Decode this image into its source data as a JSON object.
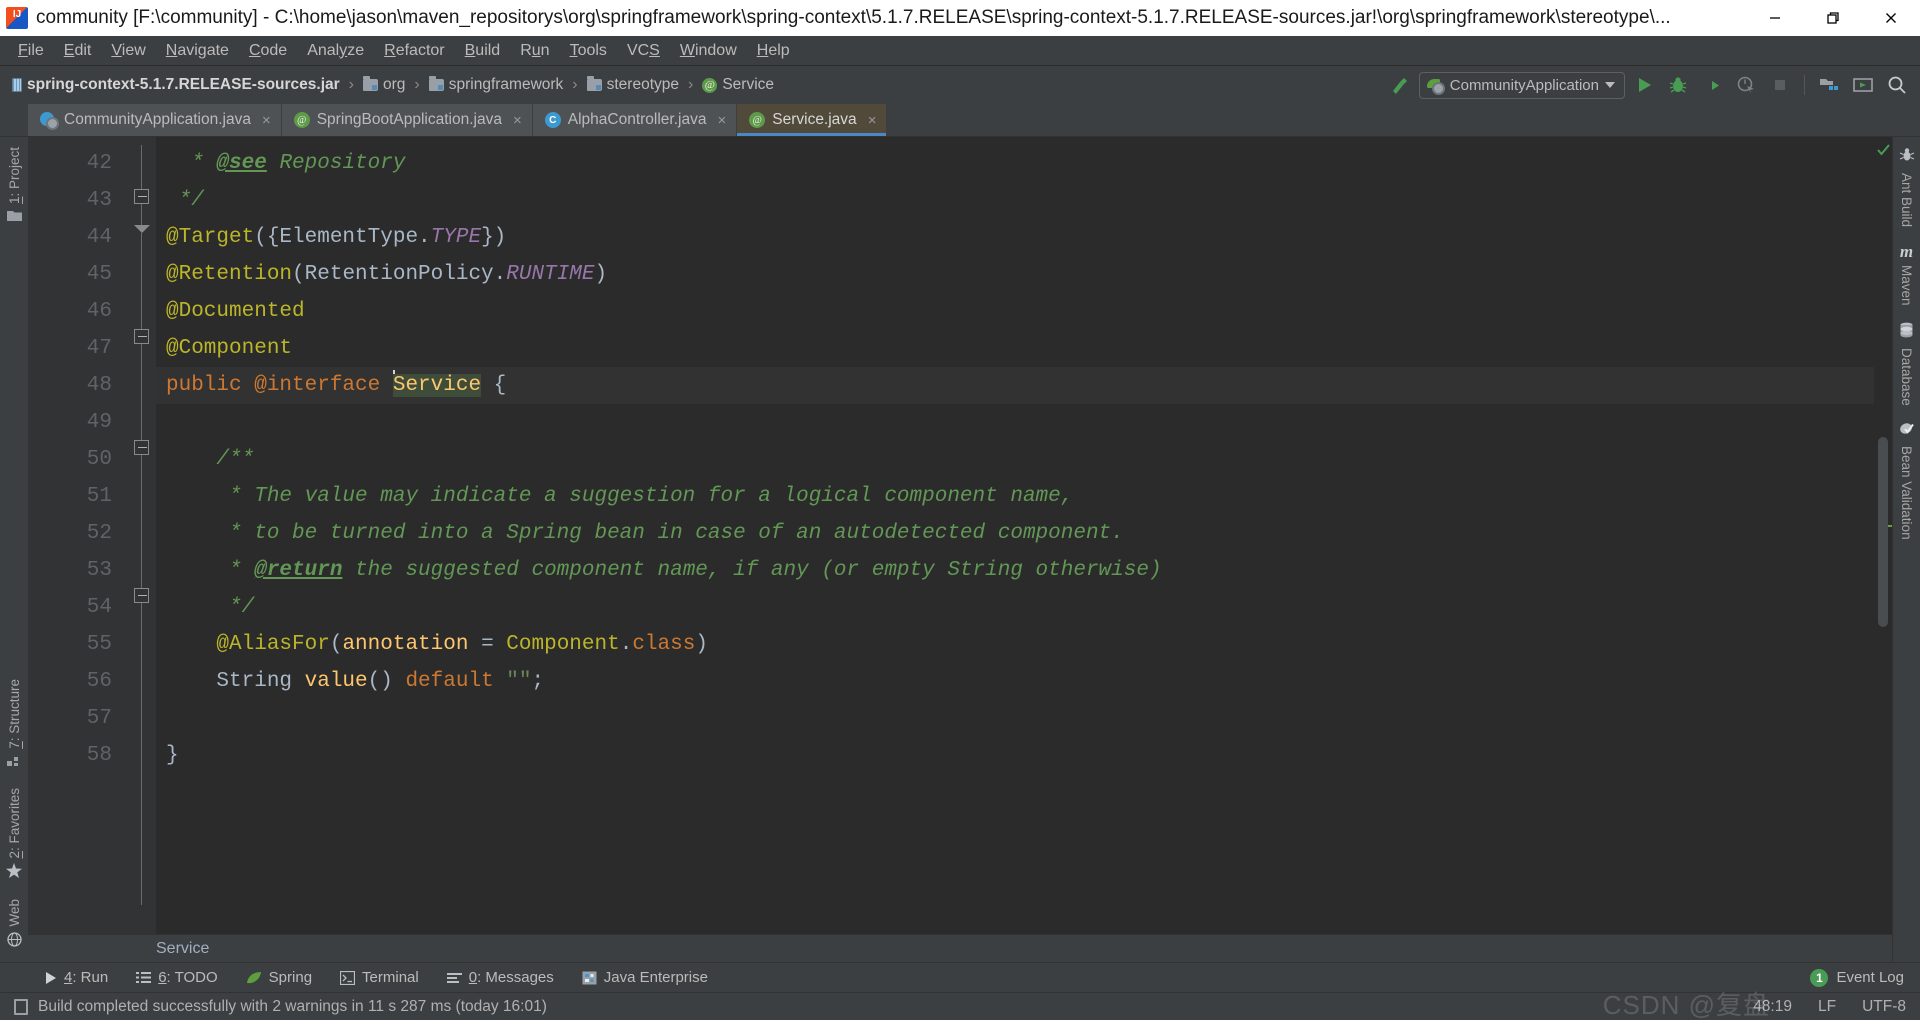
{
  "window": {
    "title": "community [F:\\community] - C:\\home\\jason\\maven_repositorys\\org\\springframework\\spring-context\\5.1.7.RELEASE\\spring-context-5.1.7.RELEASE-sources.jar!\\org\\springframework\\stereotype\\...",
    "app_icon": "intellij-idea-icon",
    "controls": {
      "minimize": "minimize-icon",
      "restore": "restore-icon",
      "close": "close-icon"
    }
  },
  "menubar": {
    "items": [
      {
        "pre": "",
        "mn": "F",
        "post": "ile"
      },
      {
        "pre": "",
        "mn": "E",
        "post": "dit"
      },
      {
        "pre": "",
        "mn": "V",
        "post": "iew"
      },
      {
        "pre": "",
        "mn": "N",
        "post": "avigate"
      },
      {
        "pre": "",
        "mn": "C",
        "post": "ode"
      },
      {
        "pre": "Anal",
        "mn": "y",
        "post": "ze"
      },
      {
        "pre": "",
        "mn": "R",
        "post": "efactor"
      },
      {
        "pre": "",
        "mn": "B",
        "post": "uild"
      },
      {
        "pre": "R",
        "mn": "u",
        "post": "n"
      },
      {
        "pre": "",
        "mn": "T",
        "post": "ools"
      },
      {
        "pre": "VC",
        "mn": "S",
        "post": ""
      },
      {
        "pre": "",
        "mn": "W",
        "post": "indow"
      },
      {
        "pre": "",
        "mn": "H",
        "post": "elp"
      }
    ]
  },
  "navbar": {
    "crumbs": [
      {
        "label": "spring-context-5.1.7.RELEASE-sources.jar",
        "icon": "jar-icon"
      },
      {
        "label": "org",
        "icon": "folder-icon"
      },
      {
        "label": "springframework",
        "icon": "folder-icon"
      },
      {
        "label": "stereotype",
        "icon": "folder-icon"
      },
      {
        "label": "Service",
        "icon": "annotation-icon"
      }
    ],
    "separator": "›",
    "run_config": {
      "label": "CommunityApplication",
      "icon": "spring-boot-icon",
      "dropdown": "chevron-down-icon"
    },
    "toolbar_icons": [
      "build-hammer-icon",
      "run-icon",
      "debug-icon",
      "run-coverage-icon",
      "profiler-icon",
      "stop-icon",
      "project-structure-icon",
      "open-terminal-icon",
      "search-icon"
    ]
  },
  "tabs": [
    {
      "label": "CommunityApplication.java",
      "icon": "spring-boot-class-icon",
      "close": "×",
      "active": false
    },
    {
      "label": "SpringBootApplication.java",
      "icon": "annotation-icon",
      "close": "×",
      "active": false
    },
    {
      "label": "AlphaController.java",
      "icon": "class-icon",
      "close": "×",
      "active": false
    },
    {
      "label": "Service.java",
      "icon": "annotation-icon",
      "close": "×",
      "active": true
    }
  ],
  "sidebar_left": [
    {
      "pre": "",
      "mn": "1",
      "post": ": Project",
      "icon": "folder-icon"
    },
    {
      "pre": "",
      "mn": "7",
      "post": ": Structure",
      "icon": "structure-icon"
    },
    {
      "pre": "",
      "mn": "2",
      "post": ": Favorites",
      "icon": "star-icon"
    },
    {
      "pre": "",
      "mn": "",
      "post": "Web",
      "icon": "web-globe-icon"
    }
  ],
  "sidebar_right": [
    {
      "label": "Ant Build",
      "icon": "ant-icon"
    },
    {
      "label": "Maven",
      "icon": "maven-m-icon"
    },
    {
      "label": "Database",
      "icon": "database-icon"
    },
    {
      "label": "Bean Validation",
      "icon": "bean-validation-icon"
    }
  ],
  "editor": {
    "first_line": 42,
    "lines": [
      {
        "num": 42,
        "current": false,
        "tokens": [
          {
            "t": "  * ",
            "c": "cmt"
          },
          {
            "t": "@see",
            "c": "cmt-tag"
          },
          {
            "t": " Repository",
            "c": "cmt"
          }
        ]
      },
      {
        "num": 43,
        "current": false,
        "tokens": [
          {
            "t": " */",
            "c": "cmt"
          }
        ]
      },
      {
        "num": 44,
        "current": false,
        "tokens": [
          {
            "t": "@Target",
            "c": "anno"
          },
          {
            "t": "({ElementType.",
            "c": "typ"
          },
          {
            "t": "TYPE",
            "c": "fld"
          },
          {
            "t": "})",
            "c": "typ"
          }
        ]
      },
      {
        "num": 45,
        "current": false,
        "tokens": [
          {
            "t": "@Retention",
            "c": "anno"
          },
          {
            "t": "(RetentionPolicy.",
            "c": "typ"
          },
          {
            "t": "RUNTIME",
            "c": "fld"
          },
          {
            "t": ")",
            "c": "typ"
          }
        ]
      },
      {
        "num": 46,
        "current": false,
        "tokens": [
          {
            "t": "@Documented",
            "c": "anno"
          }
        ]
      },
      {
        "num": 47,
        "current": false,
        "tokens": [
          {
            "t": "@Component",
            "c": "anno"
          }
        ]
      },
      {
        "num": 48,
        "current": true,
        "tokens": [
          {
            "t": "public ",
            "c": "kw"
          },
          {
            "t": "@interface ",
            "c": "kw"
          },
          {
            "t": "CARET",
            "c": "caret"
          },
          {
            "t": "Service",
            "c": "sel"
          },
          {
            "t": " {",
            "c": "typ"
          }
        ]
      },
      {
        "num": 49,
        "current": false,
        "tokens": []
      },
      {
        "num": 50,
        "current": false,
        "tokens": [
          {
            "t": "    /**",
            "c": "cmt"
          }
        ]
      },
      {
        "num": 51,
        "current": false,
        "tokens": [
          {
            "t": "     * The value may indicate a suggestion for a logical component name,",
            "c": "cmt"
          }
        ]
      },
      {
        "num": 52,
        "current": false,
        "tokens": [
          {
            "t": "     * to be turned into a Spring bean in case of an autodetected component.",
            "c": "cmt"
          }
        ]
      },
      {
        "num": 53,
        "current": false,
        "tokens": [
          {
            "t": "     * ",
            "c": "cmt"
          },
          {
            "t": "@return",
            "c": "cmt-tag"
          },
          {
            "t": " the suggested component name, if any (or empty String otherwise)",
            "c": "cmt"
          }
        ]
      },
      {
        "num": 54,
        "current": false,
        "tokens": [
          {
            "t": "     */",
            "c": "cmt"
          }
        ]
      },
      {
        "num": 55,
        "current": false,
        "tokens": [
          {
            "t": "    @AliasFor",
            "c": "anno"
          },
          {
            "t": "(",
            "c": "typ"
          },
          {
            "t": "annotation",
            "c": "ident"
          },
          {
            "t": " = ",
            "c": "typ"
          },
          {
            "t": "Component",
            "c": "anno"
          },
          {
            "t": ".",
            "c": "typ"
          },
          {
            "t": "class",
            "c": "kw"
          },
          {
            "t": ")",
            "c": "typ"
          }
        ]
      },
      {
        "num": 56,
        "current": false,
        "tokens": [
          {
            "t": "    String ",
            "c": "typ"
          },
          {
            "t": "value",
            "c": "ident"
          },
          {
            "t": "() ",
            "c": "typ"
          },
          {
            "t": "default ",
            "c": "kw"
          },
          {
            "t": "\"\"",
            "c": "str"
          },
          {
            "t": ";",
            "c": "typ"
          }
        ]
      },
      {
        "num": 57,
        "current": false,
        "tokens": []
      },
      {
        "num": 58,
        "current": false,
        "tokens": [
          {
            "t": "}",
            "c": "typ"
          }
        ]
      }
    ],
    "breadcrumb_bottom": "Service",
    "inspection_status": "ok-check-icon"
  },
  "bottombar": {
    "tools": [
      {
        "pre": "",
        "mn": "4",
        "post": ": Run",
        "icon": "run-icon"
      },
      {
        "pre": "",
        "mn": "6",
        "post": ": TODO",
        "icon": "todo-list-icon"
      },
      {
        "pre": "",
        "mn": "",
        "post": "Spring",
        "icon": "spring-leaf-icon"
      },
      {
        "pre": "",
        "mn": "",
        "post": "Terminal",
        "icon": "terminal-icon"
      },
      {
        "pre": "",
        "mn": "0",
        "post": ": Messages",
        "icon": "messages-icon"
      },
      {
        "pre": "",
        "mn": "",
        "post": "Java Enterprise",
        "icon": "java-enterprise-icon"
      }
    ],
    "event_log": {
      "label": "Event Log",
      "count": "1"
    }
  },
  "statusbar": {
    "message": "Build completed successfully with 2 warnings in 11 s 287 ms (today 16:01)",
    "message_icon": "book-icon",
    "caret_position": "48:19",
    "line_separator": "LF",
    "encoding": "UTF-8",
    "watermark": "CSDN @复盘"
  },
  "colors": {
    "editor_bg": "#2b2b2b",
    "gutter_bg": "#313335",
    "chrome_bg": "#3c3f41",
    "tab_active_bg": "#51493a",
    "tab_underline": "#4a88c7",
    "accent_green": "#499c54",
    "keyword": "#cc7832",
    "annotation": "#bbb529",
    "comment": "#629755",
    "string": "#6a8759",
    "field": "#9876aa",
    "identifier": "#ffc66d",
    "default_text": "#a9b7c6"
  }
}
